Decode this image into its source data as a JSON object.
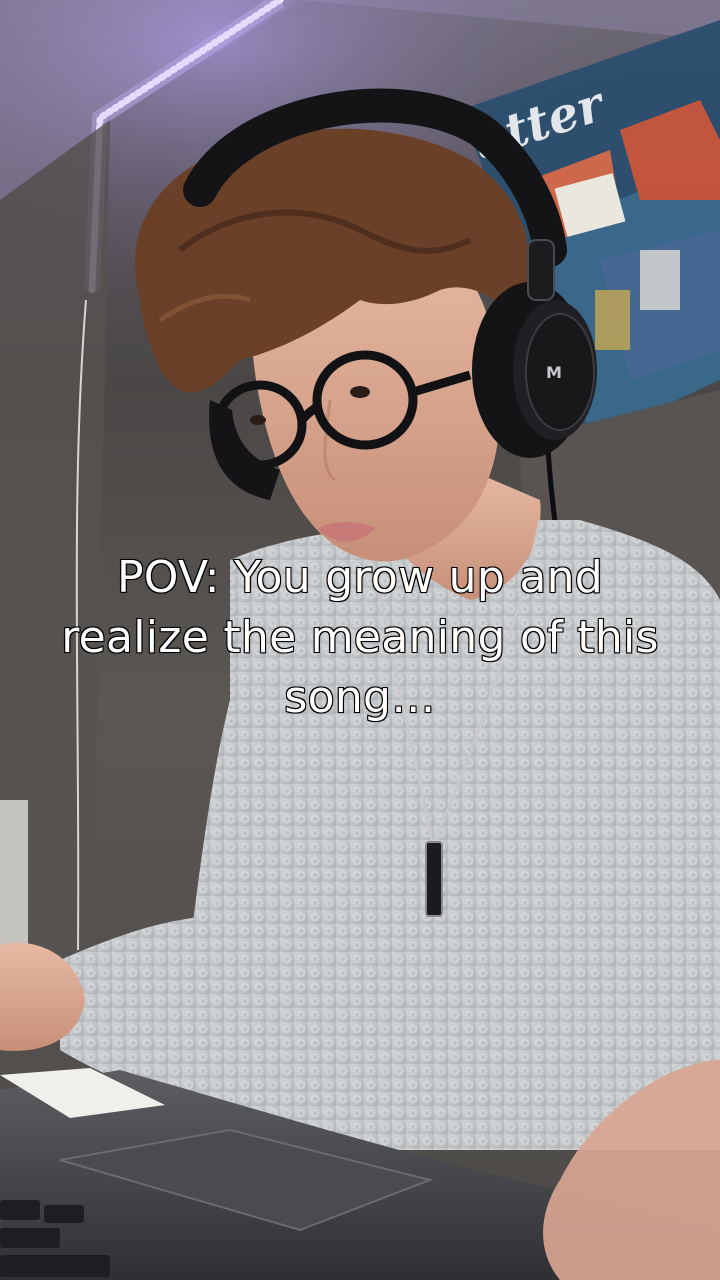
{
  "video": {
    "caption": "POV: You grow up and realize the meaning of this song…",
    "poster_text": "Butter"
  },
  "colors": {
    "led_strip": "#c9b8ff",
    "sweater": "#c9ccce",
    "headphones": "#141416",
    "hair": "#6b4028",
    "wall": "#4c4a48"
  }
}
